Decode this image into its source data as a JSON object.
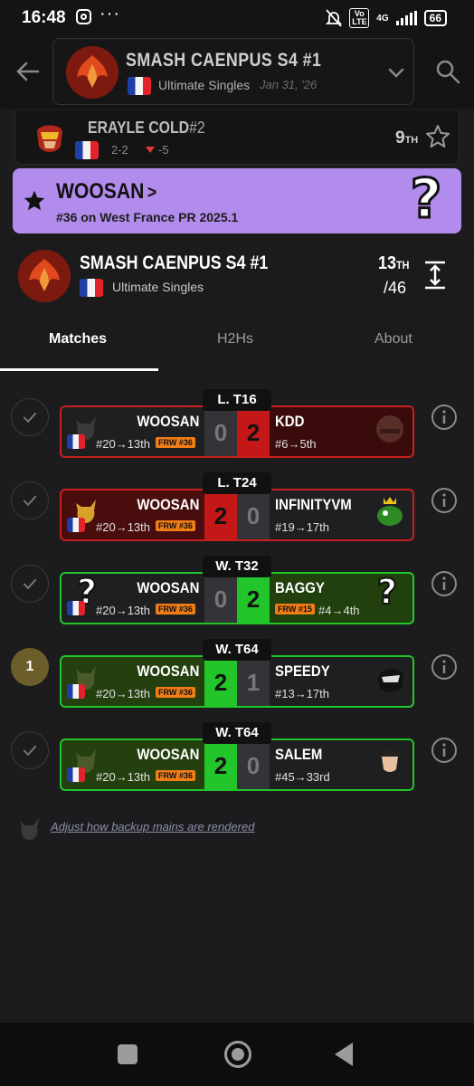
{
  "status_bar": {
    "time": "16:48",
    "volte": "Vo LTE",
    "network": "4G",
    "battery": "66"
  },
  "app_bar": {
    "tournament_title": "SMASH CAENPUS S4 #1",
    "event_name": "Ultimate Singles",
    "date": "Jan 31, '26"
  },
  "prev_player": {
    "name": "ERAYLE COLD",
    "seed": "#2",
    "score": "2-2",
    "delta": "-5",
    "placement": "9",
    "placement_suffix": "TH"
  },
  "player_banner": {
    "name": "WOOSAN",
    "chevron": ">",
    "pr_text": "#36 on West France PR 2025.1",
    "question": "?"
  },
  "event_header": {
    "title": "SMASH CAENPUS S4 #1",
    "event_name": "Ultimate Singles",
    "placement": "13",
    "placement_suffix": "TH",
    "total": "/46"
  },
  "tabs": {
    "matches": "Matches",
    "h2hs": "H2Hs",
    "about": "About"
  },
  "matches": [
    {
      "round": "L. T16",
      "status": "check",
      "left": {
        "name": "WOOSAN",
        "seed": "#20→13th",
        "frw": "FRW #36",
        "score": "0"
      },
      "right": {
        "name": "KDD",
        "seed": "#6→5th",
        "score": "2"
      }
    },
    {
      "round": "L. T24",
      "status": "check",
      "left": {
        "name": "WOOSAN",
        "seed": "#20→13th",
        "frw": "FRW #36",
        "score": "2"
      },
      "right": {
        "name": "INFINITYVM",
        "seed": "#19→17th",
        "score": "0"
      }
    },
    {
      "round": "W. T32",
      "status": "check",
      "left": {
        "name": "WOOSAN",
        "seed": "#20→13th",
        "frw": "FRW #36",
        "score": "0",
        "question": "?"
      },
      "right": {
        "name": "BAGGY",
        "frw": "FRW #15",
        "seed": "#4→4th",
        "score": "2",
        "question": "?"
      }
    },
    {
      "round": "W. T64",
      "status": "1",
      "left": {
        "name": "WOOSAN",
        "seed": "#20→13th",
        "frw": "FRW #36",
        "score": "2"
      },
      "right": {
        "name": "SPEEDY",
        "seed": "#13→17th",
        "score": "1"
      }
    },
    {
      "round": "W. T64",
      "status": "check",
      "left": {
        "name": "WOOSAN",
        "seed": "#20→13th",
        "frw": "FRW #36",
        "score": "2"
      },
      "right": {
        "name": "SALEM",
        "seed": "#45→33rd",
        "score": "0"
      }
    }
  ],
  "adjust_link": "Adjust how backup mains are rendered",
  "colors": {
    "banner": "#b28cec",
    "win": "#22c52a",
    "loss": "#c41818",
    "frw_badge": "#f07d16"
  },
  "icons": [
    "back-arrow-icon",
    "chevron-down-icon",
    "search-icon",
    "star-outline-icon",
    "star-filled-icon",
    "expand-icon",
    "check-icon",
    "info-icon"
  ]
}
